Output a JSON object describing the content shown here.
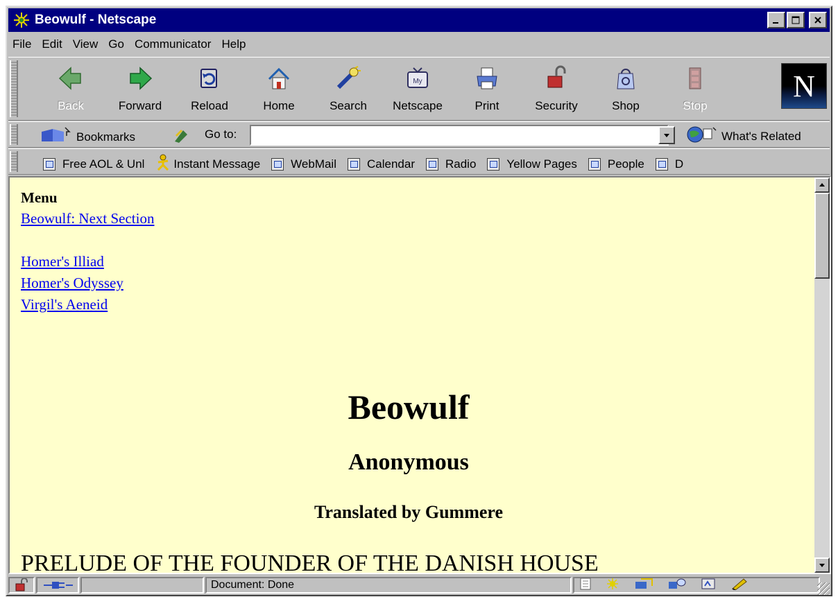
{
  "window": {
    "title": "Beowulf - Netscape"
  },
  "menubar": {
    "items": [
      {
        "label": "File"
      },
      {
        "label": "Edit"
      },
      {
        "label": "View"
      },
      {
        "label": "Go"
      },
      {
        "label": "Communicator"
      },
      {
        "label": "Help"
      }
    ]
  },
  "navbar": {
    "buttons": [
      {
        "label": "Back",
        "icon": "back-arrow-icon",
        "disabled": true
      },
      {
        "label": "Forward",
        "icon": "forward-arrow-icon",
        "disabled": false
      },
      {
        "label": "Reload",
        "icon": "reload-icon",
        "disabled": false
      },
      {
        "label": "Home",
        "icon": "home-icon",
        "disabled": false
      },
      {
        "label": "Search",
        "icon": "search-icon",
        "disabled": false
      },
      {
        "label": "Netscape",
        "icon": "netscape-icon",
        "disabled": false
      },
      {
        "label": "Print",
        "icon": "print-icon",
        "disabled": false
      },
      {
        "label": "Security",
        "icon": "security-lock-icon",
        "disabled": false
      },
      {
        "label": "Shop",
        "icon": "shop-icon",
        "disabled": false
      },
      {
        "label": "Stop",
        "icon": "stop-icon",
        "disabled": true
      }
    ],
    "logo_letter": "N"
  },
  "location": {
    "bookmarks_label": "Bookmarks",
    "goto_label": "Go to:",
    "url_value": "",
    "related_label": "What's Related"
  },
  "personal_toolbar": {
    "items": [
      {
        "label": "Free AOL & Unl",
        "icon": "bookmark-page-icon"
      },
      {
        "label": "Instant Message",
        "icon": "instant-message-icon"
      },
      {
        "label": "WebMail",
        "icon": "bookmark-page-icon"
      },
      {
        "label": "Calendar",
        "icon": "bookmark-page-icon"
      },
      {
        "label": "Radio",
        "icon": "bookmark-page-icon"
      },
      {
        "label": "Yellow Pages",
        "icon": "bookmark-page-icon"
      },
      {
        "label": "People",
        "icon": "bookmark-page-icon"
      },
      {
        "label": "D",
        "icon": "bookmark-page-icon"
      }
    ]
  },
  "page": {
    "menu_heading": "Menu",
    "links": {
      "next_section": "Beowulf: Next Section",
      "illiad": "Homer's Illiad",
      "odyssey": "Homer's Odyssey",
      "aeneid": "Virgil's Aeneid"
    },
    "title": "Beowulf",
    "author": "Anonymous",
    "translator": "Translated by Gummere",
    "prelude": "PRELUDE OF THE FOUNDER OF THE DANISH HOUSE"
  },
  "statusbar": {
    "text": "Document: Done"
  },
  "colors": {
    "titlebar": "#000080",
    "page_background": "#ffffcc",
    "link": "#0000ee",
    "chrome": "#c0c0c0"
  }
}
